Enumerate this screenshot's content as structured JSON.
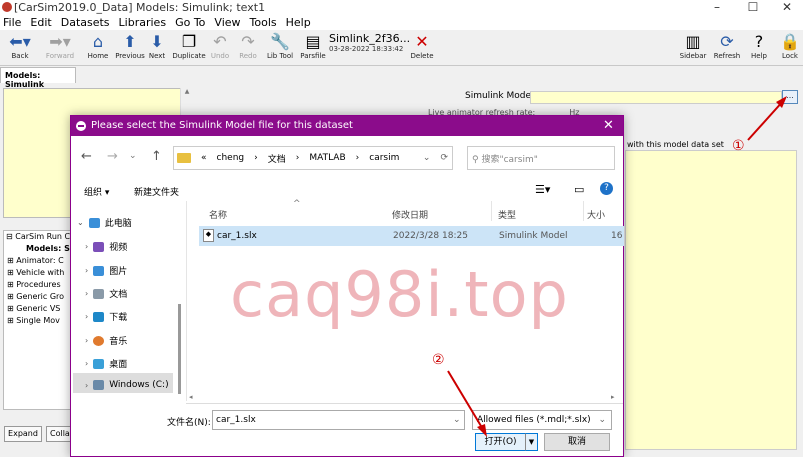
{
  "window": {
    "title": "[CarSim2019.0_Data] Models: Simulink; text1",
    "minimize": "–",
    "maximize": "☐",
    "close": "✕"
  },
  "menu": [
    "File",
    "Edit",
    "Datasets",
    "Libraries",
    "Go To",
    "View",
    "Tools",
    "Help"
  ],
  "toolbar": {
    "back": "Back",
    "forward": "Forward",
    "home": "Home",
    "previous": "Previous",
    "next": "Next",
    "duplicate": "Duplicate",
    "undo": "Undo",
    "redo": "Redo",
    "libtool": "Lib Tool",
    "parsfile": "Parsfile",
    "delete": "Delete",
    "sidebar": "Sidebar",
    "refresh": "Refresh",
    "help": "Help",
    "lock": "Lock",
    "dataset_name": "Simlink_2f36...",
    "dataset_date": "03-28-2022 18:33:42"
  },
  "tab": "Models: Simulink",
  "tree": {
    "root": "CarSim Run C",
    "items": [
      "Models: Sim",
      "Animator: C",
      "Vehicle with",
      "Procedures",
      "Generic Gro",
      "Generic VS",
      "Single Mov"
    ]
  },
  "buttons": {
    "expand": "Expand",
    "collapse": "Colla"
  },
  "right": {
    "simulink_label": "Simulink Model:",
    "browse": "...",
    "animator_label": "Live animator refresh rate:",
    "hz": "Hz",
    "assoc_label": "with this model data set"
  },
  "dialog": {
    "title": "Please select the Simulink Model file for this dataset",
    "close": "✕",
    "path": [
      "cheng",
      "文档",
      "MATLAB",
      "carsim"
    ],
    "path_prefix": "«",
    "search_placeholder": "搜索\"carsim\"",
    "organize": "组织 ▾",
    "new_folder": "新建文件夹",
    "nav": [
      {
        "label": "此电脑",
        "icon": "pc-icon"
      },
      {
        "label": "视频",
        "icon": "video-icon"
      },
      {
        "label": "图片",
        "icon": "pictures-icon"
      },
      {
        "label": "文档",
        "icon": "documents-icon"
      },
      {
        "label": "下载",
        "icon": "download-icon"
      },
      {
        "label": "音乐",
        "icon": "music-icon"
      },
      {
        "label": "桌面",
        "icon": "desktop-icon"
      },
      {
        "label": "Windows (C:)",
        "icon": "drive-icon"
      }
    ],
    "columns": {
      "name": "名称",
      "date": "修改日期",
      "type": "类型",
      "size": "大小"
    },
    "file": {
      "name": "car_1.slx",
      "date": "2022/3/28 18:25",
      "type": "Simulink Model",
      "size": "16"
    },
    "filename_label": "文件名(N):",
    "filename_value": "car_1.slx",
    "filetype": "Allowed files (*.mdl;*.slx)",
    "open": "打开(O)",
    "cancel": "取消"
  },
  "watermark": "caq98i.top",
  "annotations": {
    "one": "①",
    "two": "②"
  },
  "colors": {
    "dialog_title": "#8b0c8b",
    "field_yellow": "#ffffcc",
    "arrow_red": "#cc0000"
  }
}
